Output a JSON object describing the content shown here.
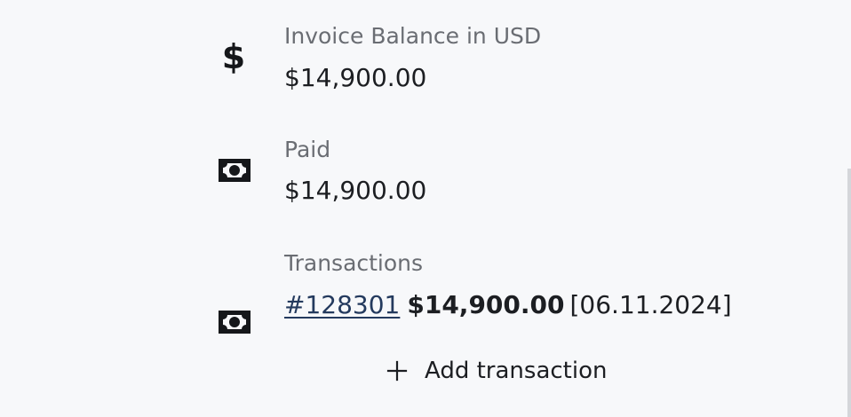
{
  "summary": {
    "balance": {
      "icon": "dollar-icon",
      "label": "Invoice Balance in USD",
      "value": "$14,900.00"
    },
    "paid": {
      "icon": "money-icon",
      "label": "Paid",
      "value": "$14,900.00"
    },
    "transactions": {
      "icon": "money-icon",
      "label": "Transactions",
      "items": [
        {
          "id": "#128301",
          "amount": "$14,900.00",
          "date": "[06.11.2024]"
        }
      ],
      "add_label": "Add transaction",
      "add_icon": "plus-icon"
    }
  },
  "colors": {
    "background": "#f7f8fa",
    "label": "#6a6d73",
    "text": "#1c1e22",
    "link": "#243a5e"
  }
}
